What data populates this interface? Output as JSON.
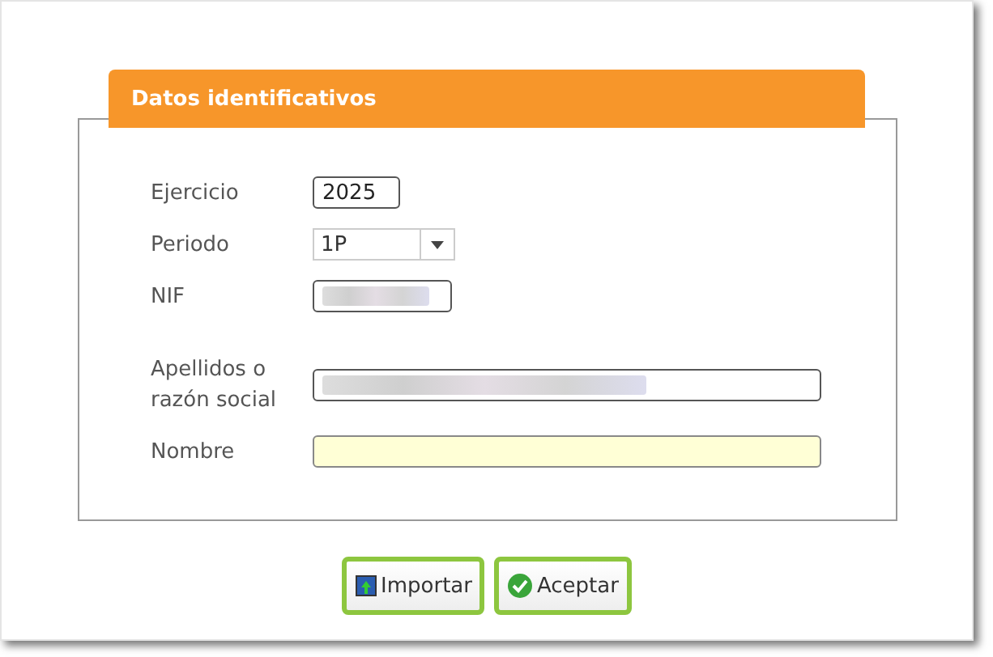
{
  "panel": {
    "title": "Datos identificativos"
  },
  "fields": [
    {
      "label": "Ejercicio",
      "kind": "text",
      "value": "2025",
      "highlighted": false
    },
    {
      "label": "Periodo",
      "kind": "select",
      "value": "1P"
    },
    {
      "label": "NIF",
      "kind": "masked",
      "highlighted": false
    },
    {
      "label": "Apellidos o razón social",
      "kind": "masked",
      "highlighted": false
    },
    {
      "label": "Nombre",
      "kind": "text",
      "highlighted": true
    }
  ],
  "buttons": [
    {
      "label": "Importar"
    },
    {
      "label": "Aceptar"
    }
  ]
}
